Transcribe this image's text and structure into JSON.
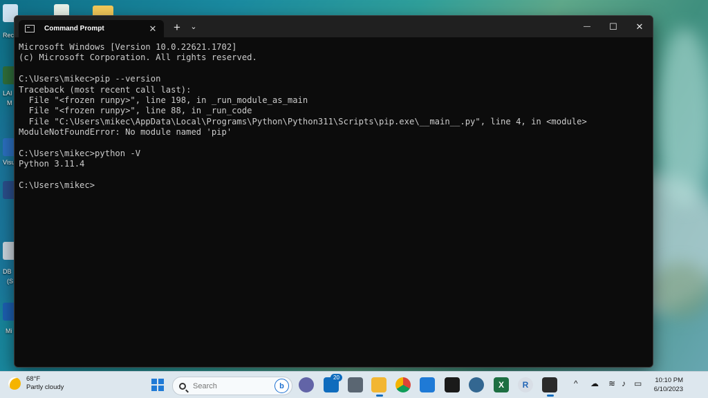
{
  "window": {
    "tab_title": "Command Prompt",
    "new_tab_symbol": "+",
    "dropdown_symbol": "⌄",
    "tab_close_symbol": "✕",
    "minimize_symbol": "—",
    "maximize_symbol": "☐",
    "close_symbol": "✕"
  },
  "terminal": {
    "lines": [
      "Microsoft Windows [Version 10.0.22621.1702]",
      "(c) Microsoft Corporation. All rights reserved.",
      "",
      "C:\\Users\\mikec>pip --version",
      "Traceback (most recent call last):",
      "  File \"<frozen runpy>\", line 198, in _run_module_as_main",
      "  File \"<frozen runpy>\", line 88, in _run_code",
      "  File \"C:\\Users\\mikec\\AppData\\Local\\Programs\\Python\\Python311\\Scripts\\pip.exe\\__main__.py\", line 4, in <module>",
      "ModuleNotFoundError: No module named 'pip'",
      "",
      "C:\\Users\\mikec>python -V",
      "Python 3.11.4",
      "",
      "C:\\Users\\mikec>"
    ]
  },
  "taskbar": {
    "weather_temp": "68°F",
    "weather_desc": "Partly cloudy",
    "search_placeholder": "Search",
    "mail_badge": "20",
    "time": "10:10 PM",
    "date": "6/10/2023",
    "r_label": "R",
    "excel_label": "X",
    "bing_label": "b"
  },
  "desktop": {
    "labels": [
      "Rec",
      "LAI",
      "M",
      "Visu",
      "DB",
      "(S",
      "Mi"
    ]
  },
  "colors": {
    "terminal_bg": "#0c0c0c",
    "terminal_fg": "#cccccc",
    "taskbar_bg": "#dde7ee",
    "accent": "#0f6cbd"
  }
}
